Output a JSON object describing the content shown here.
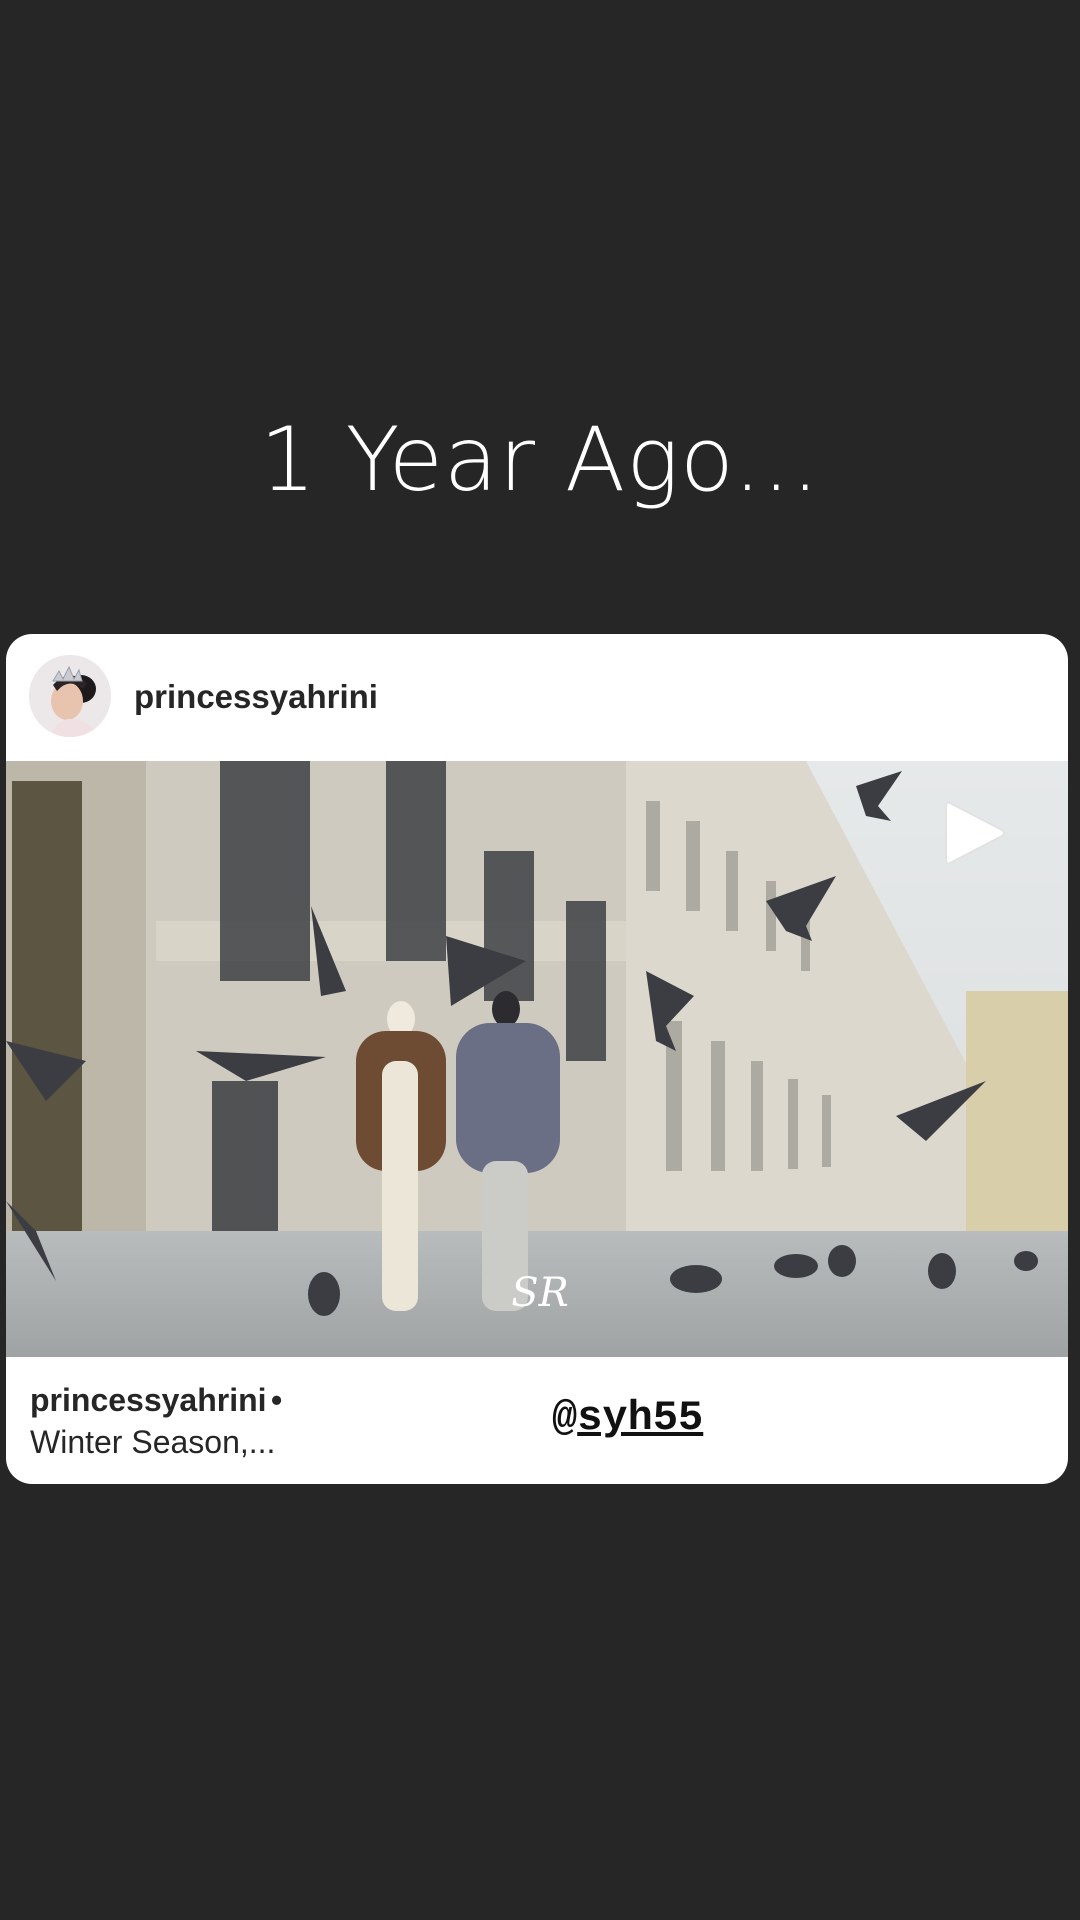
{
  "story": {
    "headline": "1 Year Ago..."
  },
  "post": {
    "author": "princessyahrini",
    "caption_user": "princessyahrini",
    "caption_separator": "•",
    "caption_text": "Winter Season,...",
    "media_type": "video",
    "play_icon": "play-icon",
    "watermark": "SR"
  },
  "sticker": {
    "at": "@",
    "handle": "syh55"
  },
  "colors": {
    "background": "#262626",
    "card": "#ffffff",
    "text": "#262626"
  }
}
